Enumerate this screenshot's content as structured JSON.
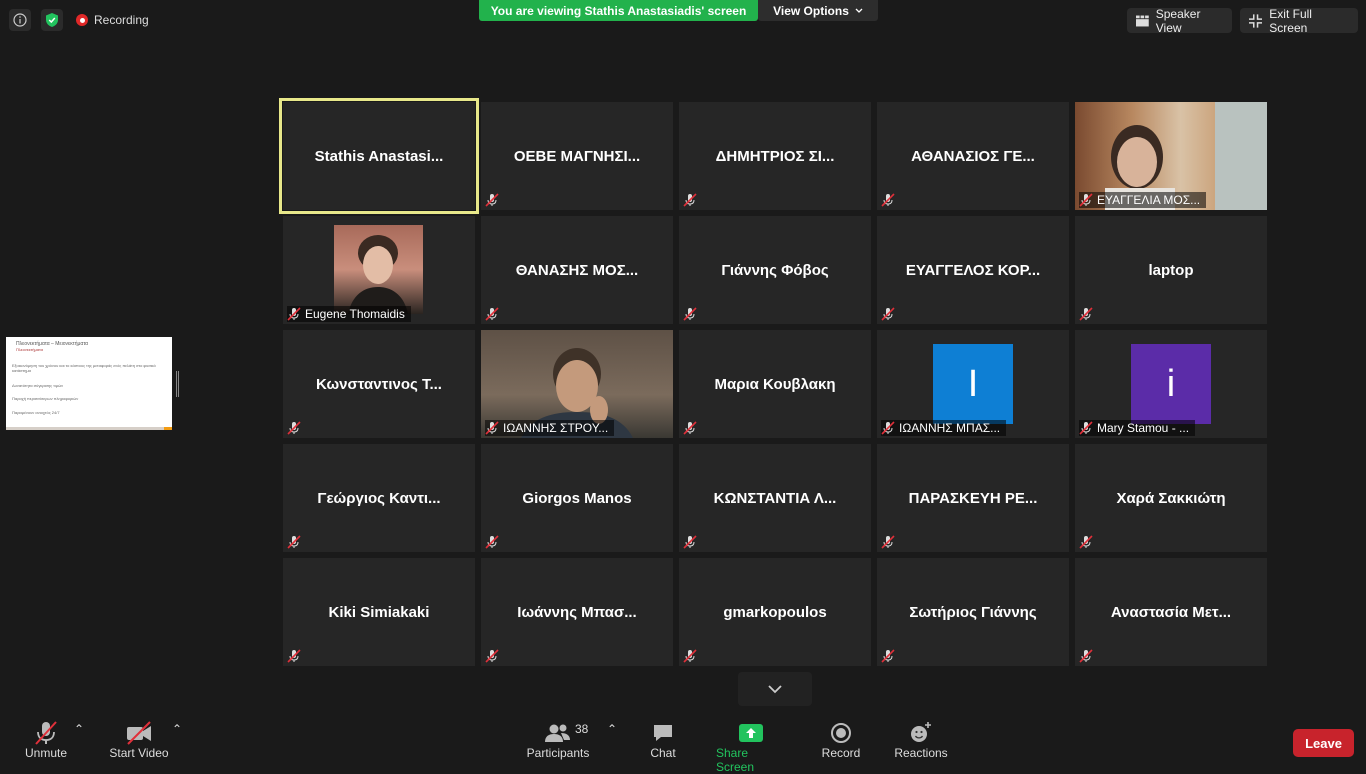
{
  "top": {
    "recording": "Recording",
    "viewing_banner": "You are viewing Stathis Anastasiadis' screen",
    "view_options": "View Options",
    "speaker_view": "Speaker View",
    "exit_full_screen": "Exit Full Screen"
  },
  "shared_thumb": {
    "title": "Πλεονεκτήματα – Μειονεκτήματα",
    "subtitle": "Πλεονεκτήματα",
    "lines": [
      "Εξοικονόμηση του χρόνου και το κόστους της μεταφοράς ενός πελάτη στο φυσικό κατάστημα",
      "Δυνατότητα σύγκρισης τιμών",
      "Παροχή περισσότερων πληροφοριών",
      "Παραμένουν ανοιχτός 24/7"
    ]
  },
  "participants": [
    {
      "name": "Stathis  Anastasi...",
      "type": "name",
      "active": true,
      "muted": false
    },
    {
      "name": "ΟΕΒΕ  ΜΑΓΝΗΣΙ...",
      "type": "name",
      "muted": true
    },
    {
      "name": "ΔΗΜΗΤΡΙΟΣ  ΣΙ...",
      "type": "name",
      "muted": true
    },
    {
      "name": "ΑΘΑΝΑΣΙΟΣ  ΓΕ...",
      "type": "name",
      "muted": true
    },
    {
      "name": "ΕΥΑΓΓΕΛΙΑ ΜΟΣ...",
      "type": "video",
      "muted": true
    },
    {
      "name": "Eugene Thomaidis",
      "type": "photo",
      "muted": true
    },
    {
      "name": "ΘΑΝΑΣΗΣ  ΜΟΣ...",
      "type": "name",
      "muted": true
    },
    {
      "name": "Γιάννης Φόβος",
      "type": "name",
      "muted": true
    },
    {
      "name": "ΕΥΑΓΓΕΛΟΣ  ΚΟΡ...",
      "type": "name",
      "muted": true
    },
    {
      "name": "laptop",
      "type": "name",
      "muted": true
    },
    {
      "name": "Κωνσταντινος Τ...",
      "type": "name",
      "muted": true
    },
    {
      "name": "ΙΩΑΝΝΗΣ ΣΤΡΟΥ...",
      "type": "video",
      "muted": true
    },
    {
      "name": "Μαρια Κουβλακη",
      "type": "name",
      "muted": true
    },
    {
      "name": "ΙΩΑΝΝΗΣ ΜΠΑΣ...",
      "type": "avatar",
      "letter": "I",
      "color": "#0e7fd4",
      "muted": true
    },
    {
      "name": "Mary Stamou - ...",
      "type": "avatar",
      "letter": "i",
      "color": "#5b2ca8",
      "muted": true
    },
    {
      "name": "Γεώργιος Καντι...",
      "type": "name",
      "muted": true
    },
    {
      "name": "Giorgos Manos",
      "type": "name",
      "muted": true
    },
    {
      "name": "ΚΩΝΣΤΑΝΤΙΑ  Λ...",
      "type": "name",
      "muted": true
    },
    {
      "name": "ΠΑΡΑΣΚΕΥΗ  ΡΕ...",
      "type": "name",
      "muted": true
    },
    {
      "name": "Χαρά Σακκιώτη",
      "type": "name",
      "muted": true
    },
    {
      "name": "Kiki Simiakaki",
      "type": "name",
      "muted": true
    },
    {
      "name": "Ιωάννης Μπασ...",
      "type": "name",
      "muted": true
    },
    {
      "name": "gmarkopoulos",
      "type": "name",
      "muted": true
    },
    {
      "name": "Σωτήριος Γιάννης",
      "type": "name",
      "muted": true
    },
    {
      "name": "Αναστασία Μετ...",
      "type": "name",
      "muted": true
    }
  ],
  "toolbar": {
    "unmute": "Unmute",
    "start_video": "Start Video",
    "participants": "Participants",
    "participant_count": "38",
    "chat": "Chat",
    "share_screen": "Share Screen",
    "record": "Record",
    "reactions": "Reactions",
    "leave": "Leave"
  },
  "colors": {
    "accent_green": "#22b24c",
    "leave_red": "#c8232c",
    "active_border": "#e8e88a"
  }
}
